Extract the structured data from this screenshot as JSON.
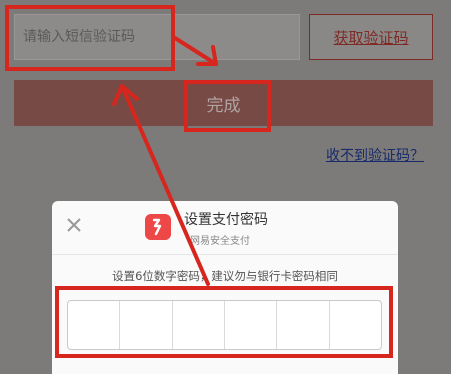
{
  "form": {
    "sms_placeholder": "请输入短信验证码",
    "get_code_label": "获取验证码",
    "done_label": "完成",
    "no_code_link": "收不到验证码？"
  },
  "sheet": {
    "close_icon": "close-icon",
    "logo_icon": "netease-pay-logo-icon",
    "title": "设置支付密码",
    "subtitle": "网易安全支付",
    "hint": "设置6位数字密码，建议勿与银行卡密码相同",
    "pin_digits": [
      "",
      "",
      "",
      "",
      "",
      ""
    ]
  },
  "colors": {
    "annotation": "#d6261e",
    "overlay_dim": "#7d7b79",
    "brand": "#ee4748"
  }
}
